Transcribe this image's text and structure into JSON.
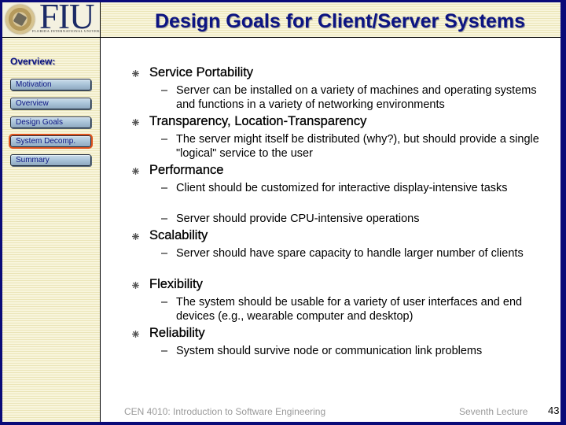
{
  "header": {
    "logo_text": "FIU",
    "logo_subtitle": "FLORIDA INTERNATIONAL UNIVERSITY",
    "title": "Design Goals for Client/Server Systems"
  },
  "sidebar": {
    "heading": "Overview:",
    "items": [
      {
        "label": "Motivation",
        "active": false
      },
      {
        "label": "Overview",
        "active": false
      },
      {
        "label": "Design Goals",
        "active": false
      },
      {
        "label": "System Decomp.",
        "active": true
      },
      {
        "label": "Summary",
        "active": false
      }
    ],
    "active_highlight_color": "#e0541e"
  },
  "content": {
    "bullet_icon": "asterisk-star",
    "sub_bullet_icon": "en-dash",
    "items": [
      {
        "heading": "Service Portability",
        "subs": [
          "Server can be installed on a variety of machines and operating systems and functions in a variety of networking environments"
        ]
      },
      {
        "heading": "Transparency, Location-Transparency",
        "subs": [
          "The server might itself be distributed (why?), but should provide a single \"logical\" service to the user"
        ]
      },
      {
        "heading": "Performance",
        "subs": [
          "Client should be customized for interactive display-intensive tasks",
          "Server should provide CPU-intensive operations"
        ]
      },
      {
        "heading": "Scalability",
        "subs": [
          "Server should have spare capacity to handle larger number of clients"
        ]
      },
      {
        "heading": "Flexibility",
        "subs": [
          "The system should be usable for a variety of user interfaces and end devices (e.g., wearable computer and desktop)"
        ]
      },
      {
        "heading": "Reliability",
        "subs": [
          "System should survive node or communication link problems"
        ]
      }
    ]
  },
  "footer": {
    "course": "CEN 4010: Introduction to Software Engineering",
    "lecture": "Seventh Lecture",
    "slide_number": "43"
  },
  "colors": {
    "frame": "#0a0a78",
    "title": "#0c1482",
    "footer_text": "#9a9a9a"
  }
}
